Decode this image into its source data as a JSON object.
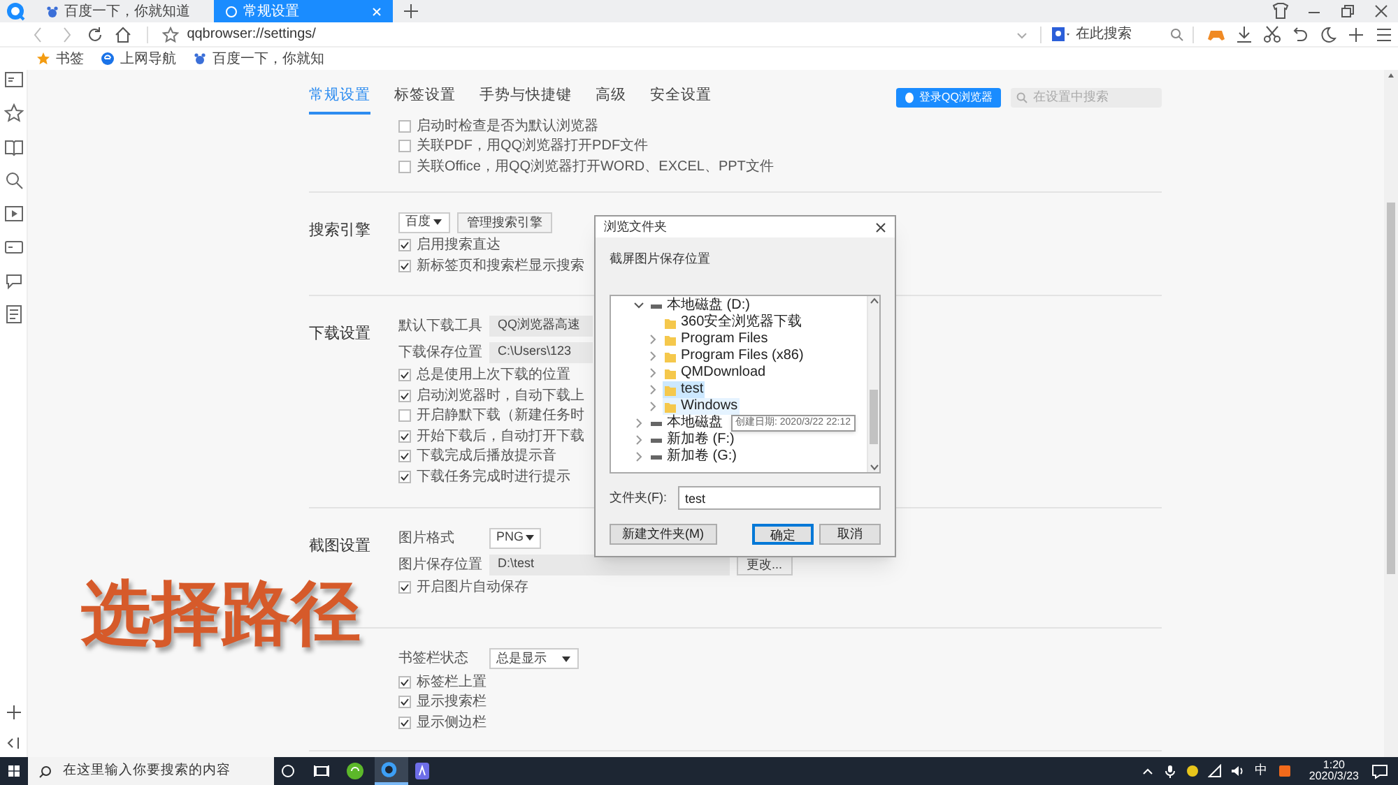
{
  "browser": {
    "tabs": [
      {
        "title": "百度一下，你就知道",
        "selected": false
      },
      {
        "title": "常规设置",
        "selected": true
      }
    ],
    "address": "qqbrowser://settings/",
    "search_placeholder": "在此搜索",
    "bookmarks": [
      "书签",
      "上网导航",
      "百度一下，你就知"
    ]
  },
  "settings": {
    "nav": [
      {
        "label": "常规设置",
        "selected": true
      },
      {
        "label": "标签设置",
        "selected": false
      },
      {
        "label": "手势与快捷键",
        "selected": false
      },
      {
        "label": "高级",
        "selected": false
      },
      {
        "label": "安全设置",
        "selected": false
      }
    ],
    "login_button": "登录QQ浏览器",
    "search_placeholder": "在设置中搜索",
    "sections": [
      {
        "rows": [
          {
            "kind": "checkbox",
            "label": "启动时检查是否为默认浏览器",
            "checked": false
          },
          {
            "kind": "checkbox",
            "label": "关联PDF，用QQ浏览器打开PDF文件",
            "checked": false
          },
          {
            "kind": "checkbox",
            "label": "关联Office，用QQ浏览器打开WORD、EXCEL、PPT文件",
            "checked": false
          }
        ]
      },
      {
        "title": "搜索引擎",
        "rows": [
          {
            "kind": "select",
            "value": "百度",
            "button": "管理搜索引擎"
          },
          {
            "kind": "checkbox",
            "label": "启用搜索直达",
            "checked": true
          },
          {
            "kind": "checkbox",
            "label": "新标签页和搜索栏显示搜索",
            "checked": true
          }
        ]
      },
      {
        "title": "下载设置",
        "rows": [
          {
            "kind": "field",
            "label": "默认下载工具",
            "value": "QQ浏览器高速"
          },
          {
            "kind": "field",
            "label": "下载保存位置",
            "value": "C:\\Users\\123"
          },
          {
            "kind": "checkbox",
            "label": "总是使用上次下载的位置",
            "checked": true
          },
          {
            "kind": "checkbox",
            "label": "启动浏览器时，自动下载上",
            "checked": true
          },
          {
            "kind": "checkbox",
            "label": "开启静默下载（新建任务时",
            "checked": false
          },
          {
            "kind": "checkbox",
            "label": "开始下载后，自动打开下载",
            "checked": true
          },
          {
            "kind": "checkbox",
            "label": "下载完成后播放提示音",
            "checked": true
          },
          {
            "kind": "checkbox",
            "label": "下载任务完成时进行提示",
            "checked": true
          }
        ]
      },
      {
        "title": "截图设置",
        "rows": [
          {
            "kind": "select",
            "label": "图片格式",
            "value": "PNG"
          },
          {
            "kind": "field",
            "label": "图片保存位置",
            "value": "D:\\test",
            "button": "更改...",
            "wide": true
          },
          {
            "kind": "checkbox",
            "label": "开启图片自动保存",
            "checked": true
          }
        ]
      },
      {
        "rows": [
          {
            "kind": "select",
            "label": "书签栏状态",
            "value": "总是显示",
            "wide": true
          },
          {
            "kind": "checkbox",
            "label": "标签栏上置",
            "checked": true
          },
          {
            "kind": "checkbox",
            "label": "显示搜索栏",
            "checked": true
          },
          {
            "kind": "checkbox",
            "label": "显示侧边栏",
            "checked": true
          }
        ]
      }
    ]
  },
  "caption": "选择路径",
  "dialog": {
    "title": "浏览文件夹",
    "description": "截屏图片保存位置",
    "tree": [
      {
        "kind": "drive",
        "label": "本地磁盘 (D:)",
        "expanded": true,
        "selected": false,
        "hovered": false,
        "children": [
          {
            "kind": "folder",
            "label": "360安全浏览器下载",
            "expandable": false,
            "selected": false,
            "hovered": false
          },
          {
            "kind": "folder",
            "label": "Program Files",
            "expandable": true,
            "selected": false,
            "hovered": false
          },
          {
            "kind": "folder",
            "label": "Program Files (x86)",
            "expandable": true,
            "selected": false,
            "hovered": false
          },
          {
            "kind": "folder",
            "label": "QMDownload",
            "expandable": true,
            "selected": false,
            "hovered": false
          },
          {
            "kind": "folder",
            "label": "test",
            "expandable": true,
            "selected": true,
            "hovered": false
          },
          {
            "kind": "folder",
            "label": "Windows",
            "expandable": true,
            "selected": false,
            "hovered": true
          }
        ]
      },
      {
        "kind": "drive",
        "label": "本地磁盘",
        "expanded": false,
        "selected": false,
        "hovered": false
      },
      {
        "kind": "drive",
        "label": "新加卷 (F:)",
        "expanded": false,
        "selected": false,
        "hovered": false
      },
      {
        "kind": "drive",
        "label": "新加卷 (G:)",
        "expanded": false,
        "selected": false,
        "hovered": false
      }
    ],
    "tooltip": "创建日期: 2020/3/22 22:12",
    "folder_label": "文件夹(F):",
    "folder_value": "test",
    "buttons": [
      {
        "label": "新建文件夹(M)",
        "default": false
      },
      {
        "label": "确定",
        "default": true
      },
      {
        "label": "取消",
        "default": false
      }
    ]
  },
  "taskbar": {
    "search_placeholder": "在这里输入你要搜索的内容",
    "ime": "中",
    "time": "1:20",
    "date": "2020/3/23"
  }
}
